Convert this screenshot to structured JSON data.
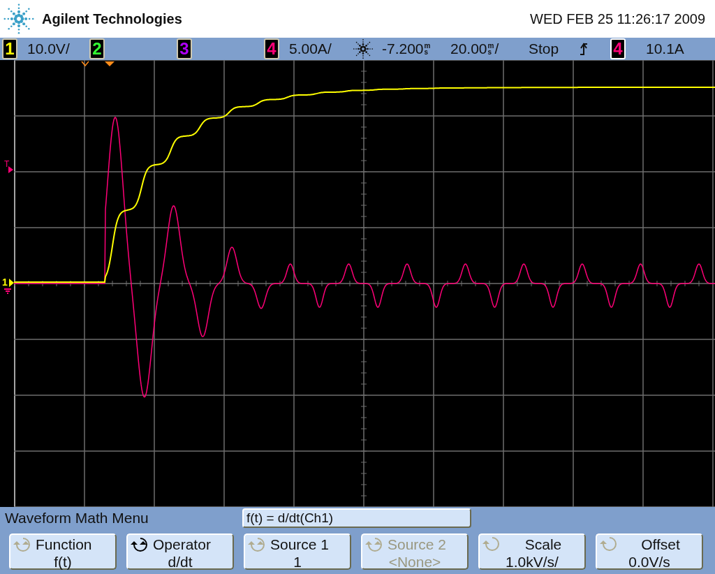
{
  "header": {
    "brand": "Agilent Technologies",
    "datetime": "WED FEB 25 11:26:17 2009"
  },
  "channels": [
    {
      "number": "1",
      "color": "#ffff00",
      "scale": "10.0V/"
    },
    {
      "number": "2",
      "color": "#33ff33"
    },
    {
      "number": "3",
      "color": "#b000ff"
    },
    {
      "number": "4",
      "color": "#ff0077",
      "scale": "5.00A/"
    }
  ],
  "timebase": {
    "delay": "-7.200",
    "delay_unit": "ms",
    "scale": "20.00",
    "scale_unit": "ms",
    "scale_suffix": "/",
    "run_state": "Stop"
  },
  "trigger": {
    "source": "4",
    "level": "10.1A"
  },
  "markers": {
    "trigger_level": "T",
    "ground": "1"
  },
  "menu": {
    "title": "Waveform Math Menu",
    "expression": "f(t) = d/dt(Ch1)"
  },
  "softkeys": [
    {
      "label": "Function",
      "value": "f(t)",
      "kind": "dual",
      "active": false,
      "disabled": false
    },
    {
      "label": "Operator",
      "value": "d/dt",
      "kind": "dual",
      "active": true,
      "disabled": false
    },
    {
      "label": "Source 1",
      "value": "1",
      "kind": "dual",
      "active": false,
      "disabled": false
    },
    {
      "label": "Source 2",
      "value": "<None>",
      "kind": "dual",
      "active": false,
      "disabled": true
    },
    {
      "label": "Scale",
      "value": "1.0kV/s/",
      "kind": "single",
      "active": false,
      "disabled": false
    },
    {
      "label": "Offset",
      "value": "0.0V/s",
      "kind": "single",
      "active": false,
      "disabled": false
    }
  ]
}
